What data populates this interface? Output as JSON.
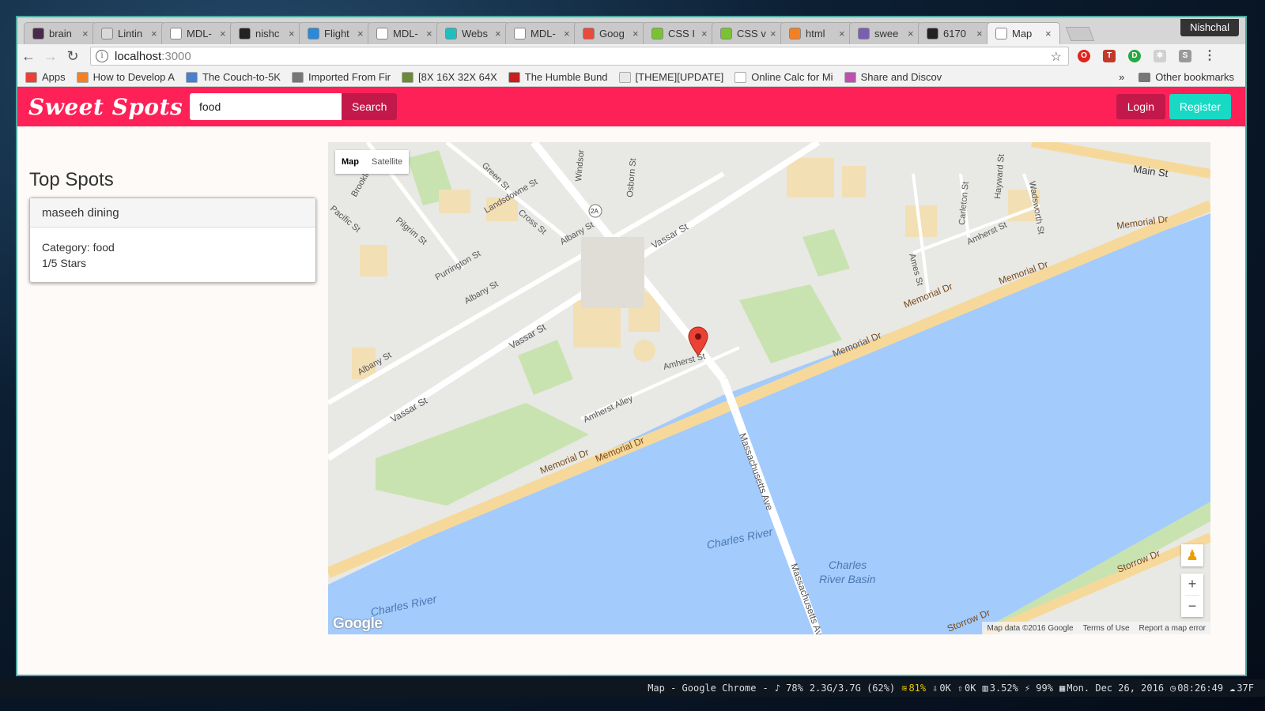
{
  "browser": {
    "profile": "Nishchal",
    "tabs": [
      {
        "label": "brain",
        "fav_color": "#4a2a4a"
      },
      {
        "label": "Lintin",
        "fav_color": "#d9d9d9"
      },
      {
        "label": "MDL-",
        "fav_color": "#ffffff"
      },
      {
        "label": "nishc",
        "fav_color": "#222222"
      },
      {
        "label": "Flight",
        "fav_color": "#2a8ad8"
      },
      {
        "label": "MDL-",
        "fav_color": "#ffffff"
      },
      {
        "label": "Webs",
        "fav_color": "#1fbfbf"
      },
      {
        "label": "MDL-",
        "fav_color": "#ffffff"
      },
      {
        "label": "Goog",
        "fav_color": "#ea4a3a"
      },
      {
        "label": "CSS I",
        "fav_color": "#79c332"
      },
      {
        "label": "CSS v",
        "fav_color": "#79c332"
      },
      {
        "label": "html",
        "fav_color": "#f48024"
      },
      {
        "label": "swee",
        "fav_color": "#7a5fb0"
      },
      {
        "label": "6170",
        "fav_color": "#222222"
      },
      {
        "label": "Map",
        "fav_color": "#ffffff"
      }
    ],
    "url_host": "localhost",
    "url_port": ":3000",
    "bookmarks": [
      {
        "label": "Apps",
        "color": "#e94235"
      },
      {
        "label": "How to Develop A",
        "color": "#f48024"
      },
      {
        "label": "The Couch-to-5K",
        "color": "#4a7fd0"
      },
      {
        "label": "Imported From Fir",
        "color": "#777777"
      },
      {
        "label": "[8X 16X 32X 64X",
        "color": "#6a8a3a"
      },
      {
        "label": "The Humble Bund",
        "color": "#c81e1e"
      },
      {
        "label": "[THEME][UPDATE]",
        "color": "#e8e8e8"
      },
      {
        "label": "Online Calc for Mi",
        "color": "#ffffff"
      },
      {
        "label": "Share and Discov",
        "color": "#c14fb0"
      }
    ],
    "overflow": "»",
    "other_bookmarks": "Other bookmarks"
  },
  "app": {
    "brand": "Sweet Spots",
    "search_value": "food",
    "search_button": "Search",
    "login": "Login",
    "register": "Register",
    "colors": {
      "nav": "#fd2157",
      "dark_button": "#c2184a",
      "register": "#18d9c4"
    }
  },
  "sidebar": {
    "title": "Top Spots",
    "spot": {
      "name": "maseeh dining",
      "category": "Category: food",
      "rating": "1/5 Stars"
    }
  },
  "map": {
    "type_map": "Map",
    "type_satellite": "Satellite",
    "labels": {
      "main_st": "Main St",
      "memorial_dr": "Memorial Dr",
      "vassar_st": "Vassar St",
      "mass_ave": "Massachusetts Ave",
      "charles_river": "Charles River",
      "charles_basin_1": "Charles",
      "charles_basin_2": "River Basin",
      "amherst_st": "Amherst St",
      "amherst_alley": "Amherst Alley",
      "albany_st": "Albany St",
      "landsdowne_st": "Landsdowne St",
      "cross_st": "Cross St",
      "green_st": "Green St",
      "pilgrim_st": "Pilgrim St",
      "purrington_st": "Purrington St",
      "pacific_st": "Pacific St",
      "brookline": "Brookline",
      "windsor": "Windsor",
      "osborn_st": "Osborn St",
      "ames_st": "Ames St",
      "carleton_st": "Carleton St",
      "hayward_st": "Hayward St",
      "wadsworth_st": "Wadsworth St",
      "storrow_dr": "Storrow Dr",
      "route": "2A"
    },
    "google": "Google",
    "attribution": "Map data ©2016 Google",
    "terms": "Terms of Use",
    "report": "Report a map error"
  },
  "taskbar": {
    "window": "Map - Google Chrome",
    "dash": "-",
    "volume": "♪ 78%",
    "memory": "2.3G/3.7G (62%)",
    "wifi": "81%",
    "down": "0K",
    "up": "0K",
    "cpu": "3.52%",
    "battery": "⚡ 99%",
    "date": "Mon. Dec 26, 2016",
    "time": "08:26:49",
    "weather": "37F"
  }
}
